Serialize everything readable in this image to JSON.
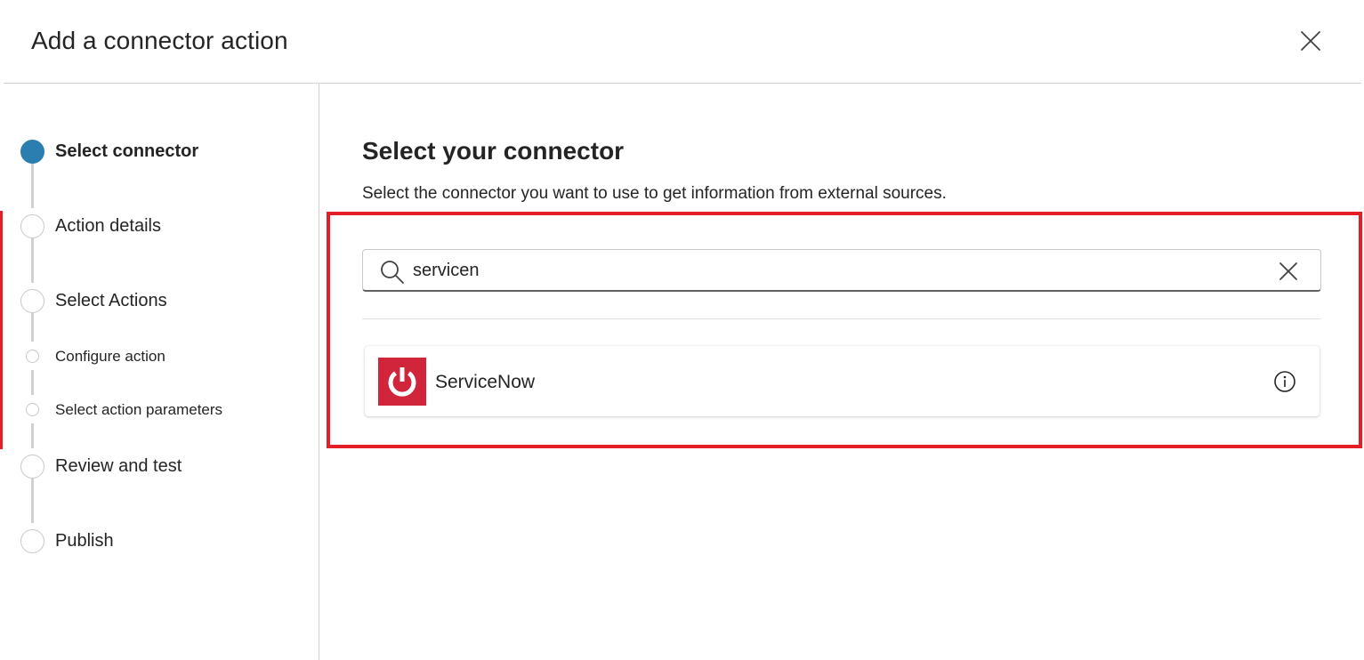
{
  "dialog": {
    "title": "Add a connector action",
    "close_icon": "close-icon"
  },
  "steps": [
    {
      "label": "Select connector",
      "state": "active"
    },
    {
      "label": "Action details",
      "state": "pending"
    },
    {
      "label": "Select Actions",
      "state": "pending"
    },
    {
      "label": "Configure action",
      "state": "pending",
      "sub": true
    },
    {
      "label": "Select action parameters",
      "state": "pending",
      "sub": true
    },
    {
      "label": "Review and test",
      "state": "pending"
    },
    {
      "label": "Publish",
      "state": "pending"
    }
  ],
  "main": {
    "title": "Select your connector",
    "subtitle": "Select the connector you want to use to get information from external sources."
  },
  "search": {
    "value": "servicen",
    "icon": "search-icon",
    "clear_icon": "close-icon"
  },
  "results": [
    {
      "name": "ServiceNow",
      "logo_icon": "power-icon",
      "info_icon": "info-icon"
    }
  ],
  "colors": {
    "accent": "#2b7fb0",
    "highlight": "#e41e26",
    "servicenow_brand": "#d0253a"
  }
}
